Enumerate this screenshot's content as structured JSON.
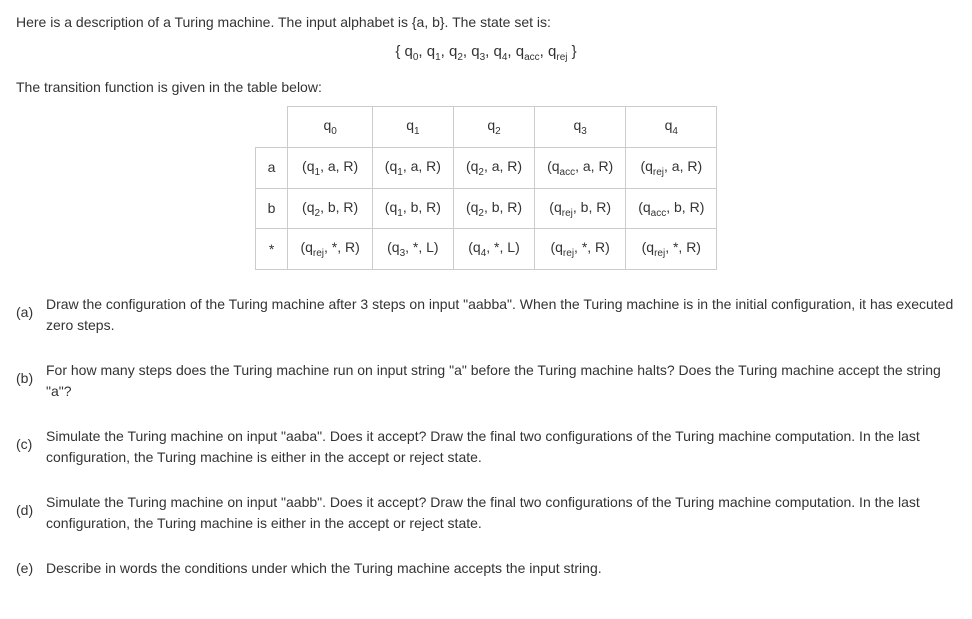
{
  "intro_text": "Here is a description of a Turing machine. The input alphabet is {a, b}. The state set is:",
  "states_display": "{ q0, q1, q2, q3, q4, qacc, qrej }",
  "transition_intro": "The transition function is given in the table below:",
  "table": {
    "col_headers": [
      "q0",
      "q1",
      "q2",
      "q3",
      "q4"
    ],
    "rows": [
      {
        "symbol": "a",
        "cells": [
          "(q1, a, R)",
          "(q1, a, R)",
          "(q2, a, R)",
          "(qacc, a, R)",
          "(qrej, a, R)"
        ]
      },
      {
        "symbol": "b",
        "cells": [
          "(q2, b, R)",
          "(q1, b, R)",
          "(q2, b, R)",
          "(qrej, b, R)",
          "(qacc, b, R)"
        ]
      },
      {
        "symbol": "*",
        "cells": [
          "(qrej, *, R)",
          "(q3, *, L)",
          "(q4, *, L)",
          "(qrej, *, R)",
          "(qrej, *, R)"
        ]
      }
    ]
  },
  "questions": {
    "a": {
      "label": "(a)",
      "text": "Draw the configuration of the Turing machine after 3 steps on input \"aabba\". When the Turing machine is in the initial configuration, it has executed zero steps."
    },
    "b": {
      "label": "(b)",
      "text": "For how many steps does the Turing machine run on input string \"a\" before the Turing machine halts? Does the Turing machine accept the string \"a\"?"
    },
    "c": {
      "label": "(c)",
      "text": "Simulate the Turing machine on input \"aaba\". Does it accept? Draw the final two configurations of the Turing machine computation. In the last configuration, the Turing machine is either in the accept or reject state."
    },
    "d": {
      "label": "(d)",
      "text": "Simulate the Turing machine on input \"aabb\". Does it accept? Draw the final two configurations of the Turing machine computation. In the last configuration, the Turing machine is either in the accept or reject state."
    },
    "e": {
      "label": "(e)",
      "text": "Describe in words the conditions under which the Turing machine accepts the input string."
    }
  }
}
